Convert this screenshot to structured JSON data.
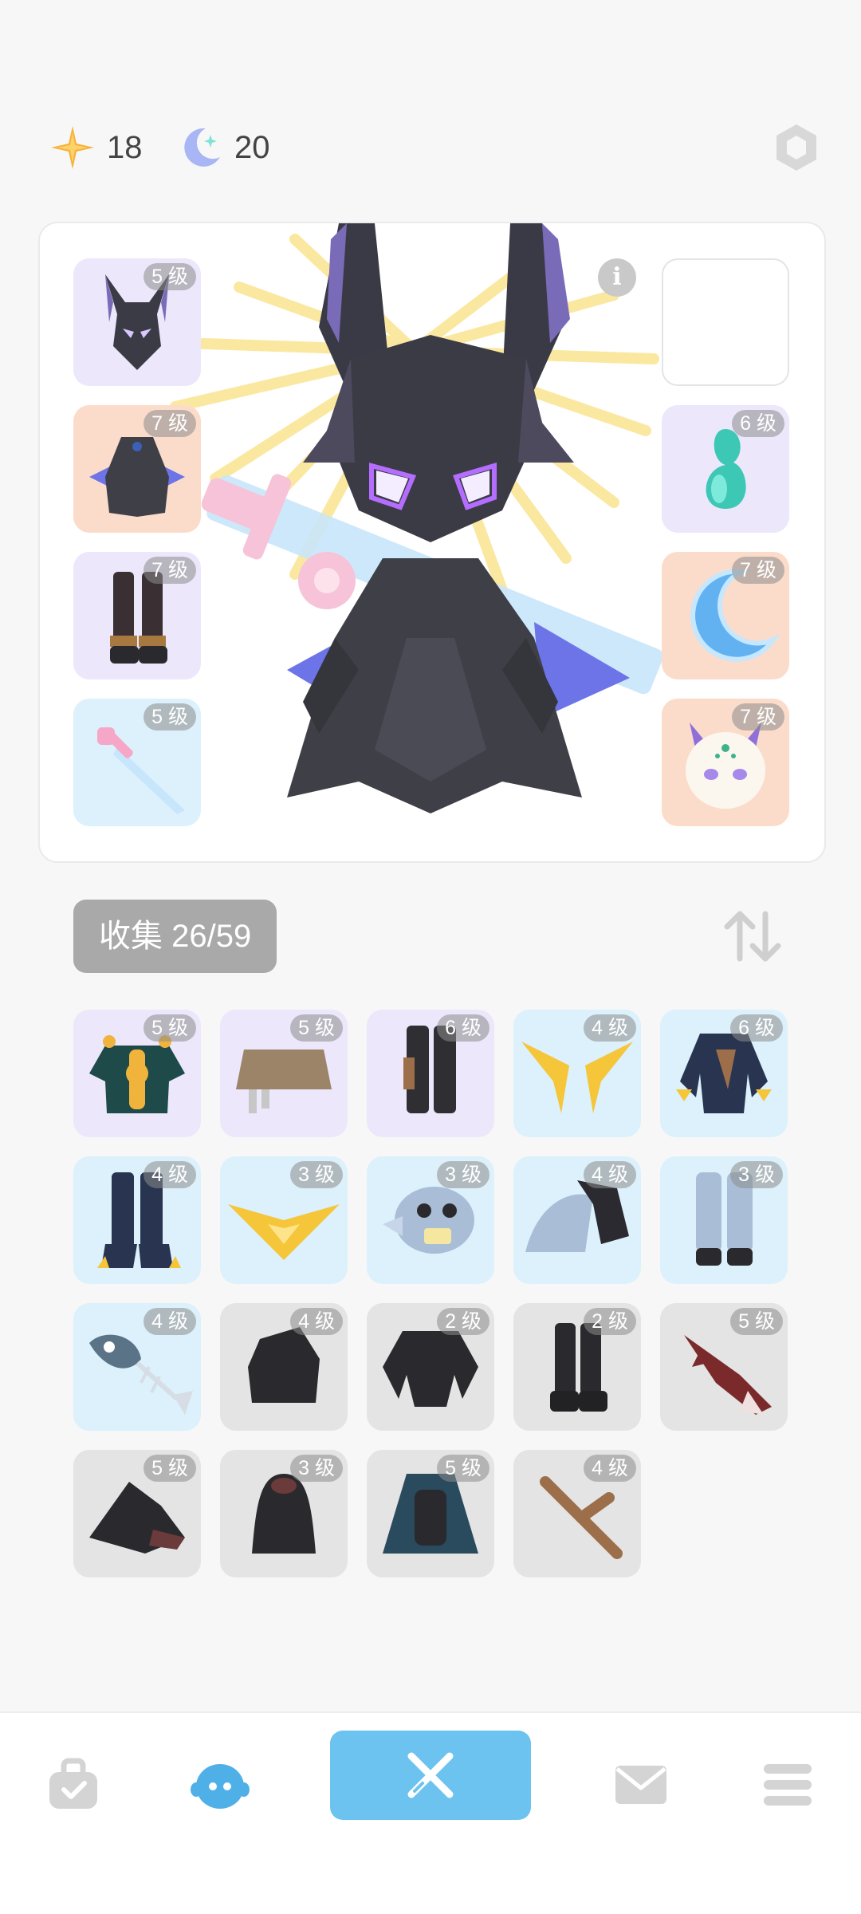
{
  "currency": {
    "stars": "18",
    "moons": "20"
  },
  "icons": {
    "star": "star-icon",
    "moon": "moon-icon",
    "settings": "hexagon-settings-icon",
    "info": "info-icon",
    "sort": "sort-arrows-icon"
  },
  "info_label": "i",
  "equipped": {
    "left": [
      {
        "item": "demon-helmet",
        "level": "5 级"
      },
      {
        "item": "dark-cape",
        "level": "7 级"
      },
      {
        "item": "dark-boots",
        "level": "7 级"
      },
      {
        "item": "pink-sword",
        "level": "5 级"
      }
    ],
    "right": [
      {
        "item": "empty",
        "level": ""
      },
      {
        "item": "teal-potion",
        "level": "6 级"
      },
      {
        "item": "blue-moon",
        "level": "7 级"
      },
      {
        "item": "cat-mask",
        "level": "7 级"
      }
    ]
  },
  "collection": {
    "label": "收集 26/59"
  },
  "grid": [
    {
      "item": "green-tunic",
      "level": "5 级",
      "bg": "purple"
    },
    {
      "item": "brown-hat",
      "level": "5 级",
      "bg": "purple"
    },
    {
      "item": "black-pants",
      "level": "6 级",
      "bg": "purple"
    },
    {
      "item": "golden-wings",
      "level": "4 级",
      "bg": "blue"
    },
    {
      "item": "claw-armor",
      "level": "6 级",
      "bg": "blue"
    },
    {
      "item": "claw-legs",
      "level": "4 级",
      "bg": "blue"
    },
    {
      "item": "gold-emblem",
      "level": "3 级",
      "bg": "blue"
    },
    {
      "item": "fish-mask",
      "level": "3 级",
      "bg": "blue"
    },
    {
      "item": "dark-wing-cape",
      "level": "4 级",
      "bg": "blue"
    },
    {
      "item": "gray-pants",
      "level": "3 级",
      "bg": "blue"
    },
    {
      "item": "fish-bone",
      "level": "4 级",
      "bg": "blue"
    },
    {
      "item": "black-rock",
      "level": "4 级",
      "bg": "gray"
    },
    {
      "item": "black-armor",
      "level": "2 级",
      "bg": "gray"
    },
    {
      "item": "black-boots",
      "level": "2 级",
      "bg": "gray"
    },
    {
      "item": "red-blade",
      "level": "5 级",
      "bg": "gray"
    },
    {
      "item": "witch-hat",
      "level": "5 级",
      "bg": "gray"
    },
    {
      "item": "black-hood",
      "level": "3 级",
      "bg": "gray"
    },
    {
      "item": "blue-cloak",
      "level": "5 级",
      "bg": "gray"
    },
    {
      "item": "wood-branch",
      "level": "4 级",
      "bg": "gray"
    }
  ],
  "nav": [
    "bag-icon",
    "character-icon",
    "battle-icon",
    "mail-icon",
    "menu-icon"
  ],
  "colors": {
    "accent": "#6cc3ef",
    "badge": "#8c8c8c",
    "purple": "#ece7fb",
    "orange": "#fbdccb",
    "blue": "#dcf1fb",
    "gray": "#e4e4e4"
  }
}
